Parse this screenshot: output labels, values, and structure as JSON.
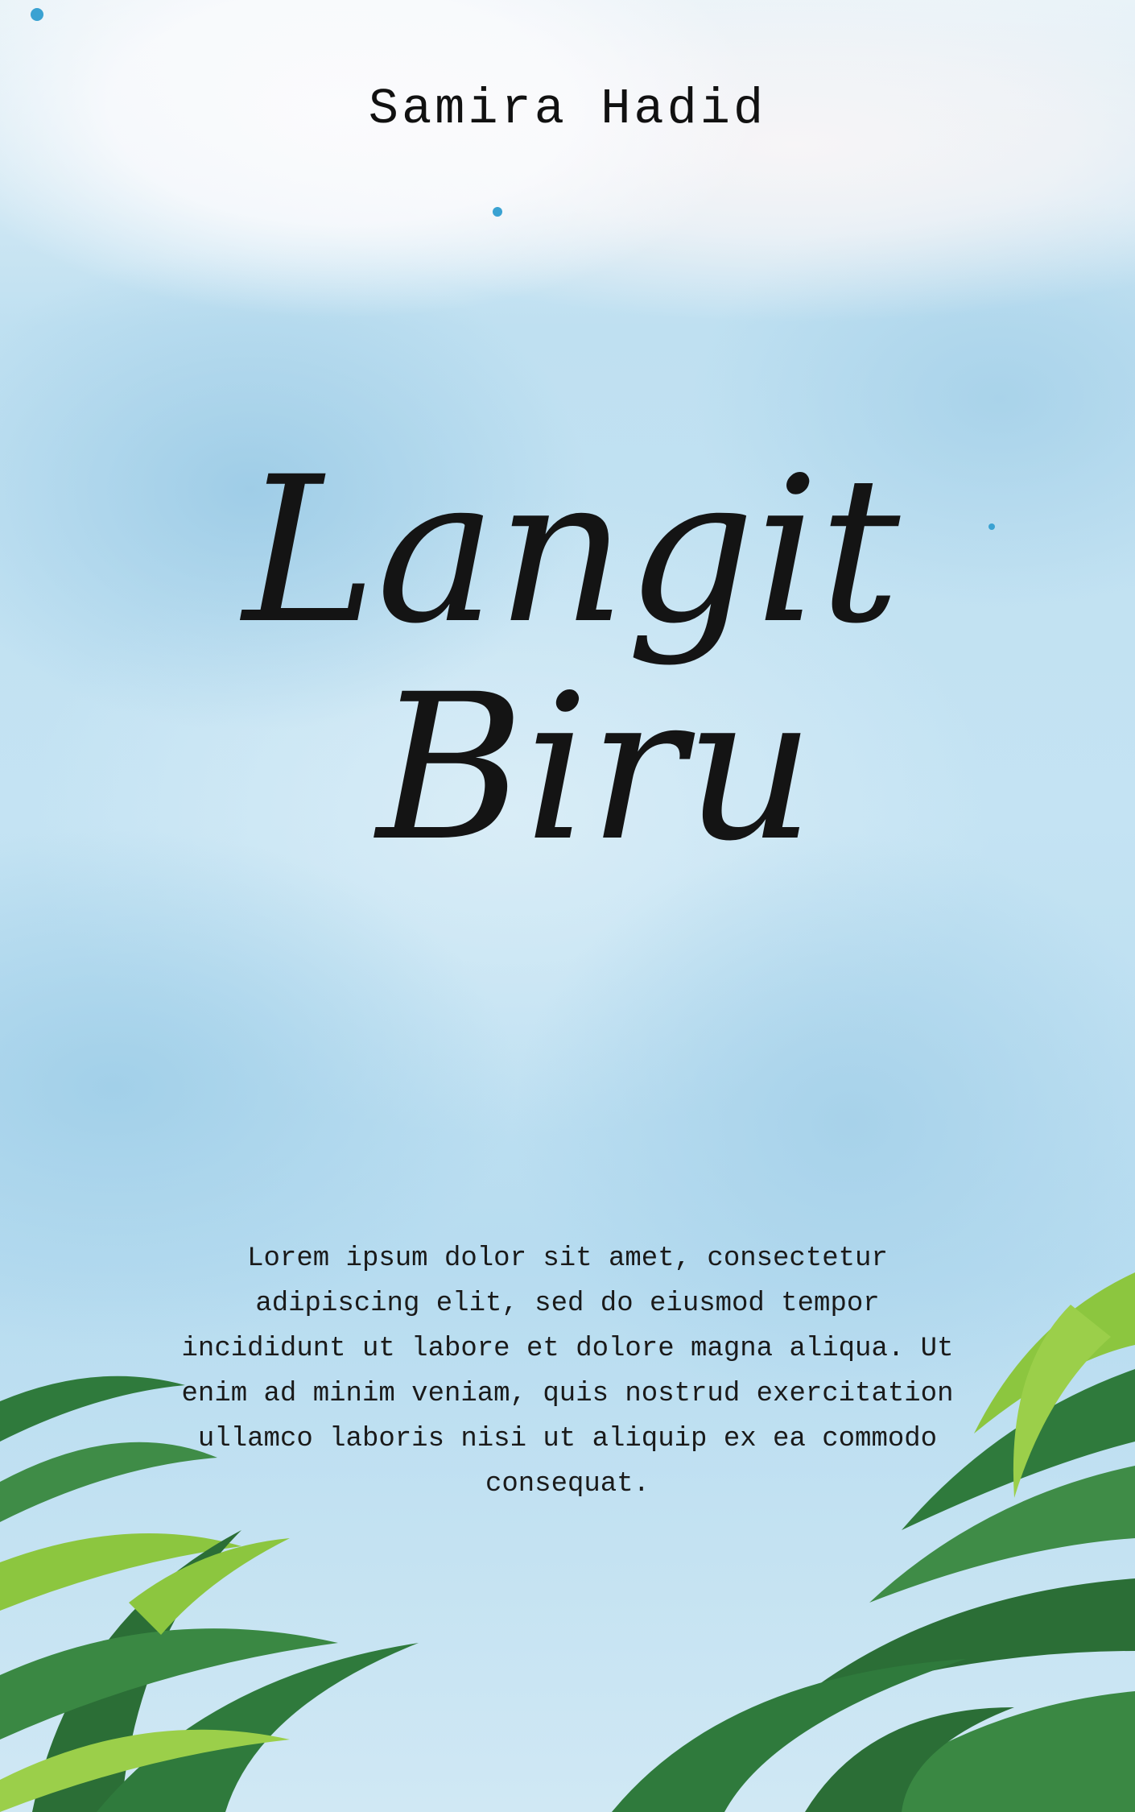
{
  "cover": {
    "author": "Samira Hadid",
    "title_line1": "Langit",
    "title_line2": "Biru",
    "blurb": "Lorem ipsum dolor sit amet, consectetur adipiscing elit, sed do eiusmod tempor incididunt ut labore et dolore magna aliqua. Ut enim ad minim veniam, quis nostrud exercitation ullamco laboris nisi ut aliquip ex ea commodo consequat."
  },
  "colors": {
    "sky": "#bfe0f1",
    "cloud": "#f7f5f7",
    "text": "#111111",
    "palm_dark": "#2f7a3c",
    "palm_light": "#8cc63f"
  }
}
